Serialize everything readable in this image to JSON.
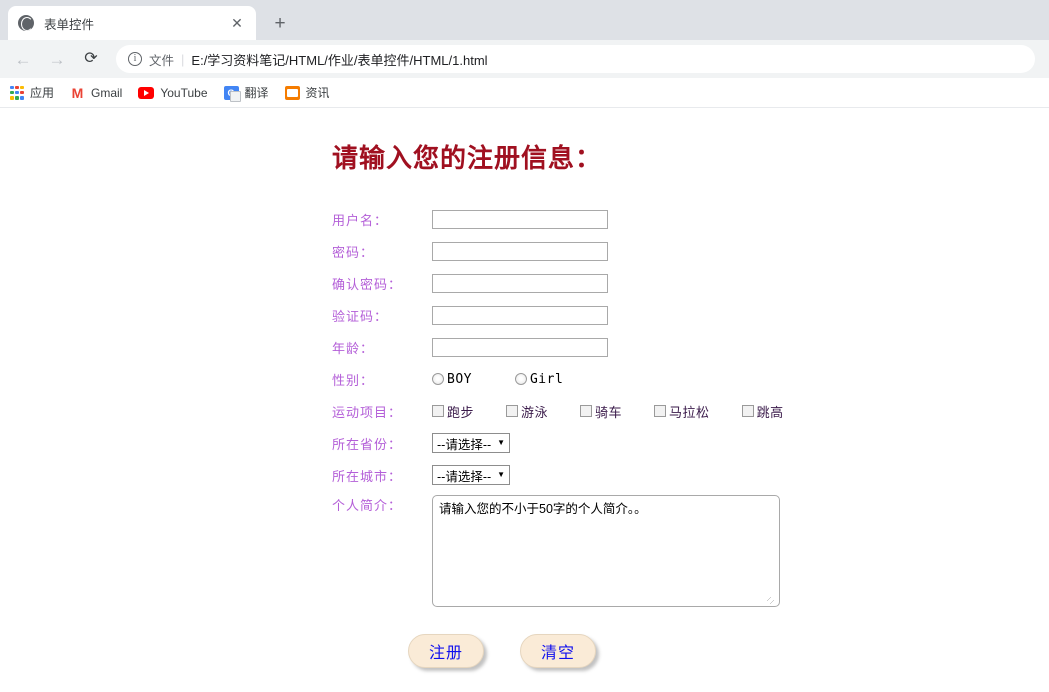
{
  "browser": {
    "tab": {
      "title": "表单控件",
      "favicon": "globe-icon",
      "close": "✕"
    },
    "new_tab": "+",
    "nav": {
      "back": "←",
      "forward": "→",
      "reload": "⟳"
    },
    "omnibox": {
      "info_icon": "i",
      "scheme_label": "文件",
      "separator": "|",
      "url": "E:/学习资料笔记/HTML/作业/表单控件/HTML/1.html"
    },
    "bookmarks": [
      {
        "label": "应用",
        "icon": "apps-grid-icon"
      },
      {
        "label": "Gmail",
        "icon": "gmail-icon"
      },
      {
        "label": "YouTube",
        "icon": "youtube-icon"
      },
      {
        "label": "翻译",
        "icon": "google-translate-icon"
      },
      {
        "label": "资讯",
        "icon": "news-icon"
      }
    ]
  },
  "page": {
    "heading": "请输入您的注册信息：",
    "labels": {
      "username": "用户名：",
      "password": "密码：",
      "confirm_password": "确认密码：",
      "captcha": "验证码：",
      "age": "年龄：",
      "gender": "性别：",
      "sports": "运动项目：",
      "province": "所在省份：",
      "city": "所在城市：",
      "bio": "个人简介："
    },
    "fields": {
      "username": {
        "value": "",
        "placeholder": ""
      },
      "password": {
        "value": "",
        "placeholder": ""
      },
      "confirm_password": {
        "value": "",
        "placeholder": ""
      },
      "captcha": {
        "value": "",
        "placeholder": ""
      },
      "age": {
        "value": "",
        "placeholder": ""
      }
    },
    "gender_options": [
      {
        "label": "BOY",
        "checked": false
      },
      {
        "label": "Girl",
        "checked": false
      }
    ],
    "sport_options": [
      {
        "label": "跑步",
        "checked": false
      },
      {
        "label": "游泳",
        "checked": false
      },
      {
        "label": "骑车",
        "checked": false
      },
      {
        "label": "马拉松",
        "checked": false
      },
      {
        "label": "跳高",
        "checked": false
      }
    ],
    "province_select": {
      "selected": "--请选择--",
      "caret": "▼"
    },
    "city_select": {
      "selected": "--请选择--",
      "caret": "▼"
    },
    "bio_field": {
      "value": "请输入您的不小于50字的个人简介。。",
      "placeholder": ""
    },
    "buttons": {
      "submit": "注册",
      "reset": "清空"
    },
    "colors": {
      "heading": "#a01020",
      "label": "#b45fd8",
      "button_bg": "#faebd7",
      "button_text": "#1010ee"
    }
  }
}
